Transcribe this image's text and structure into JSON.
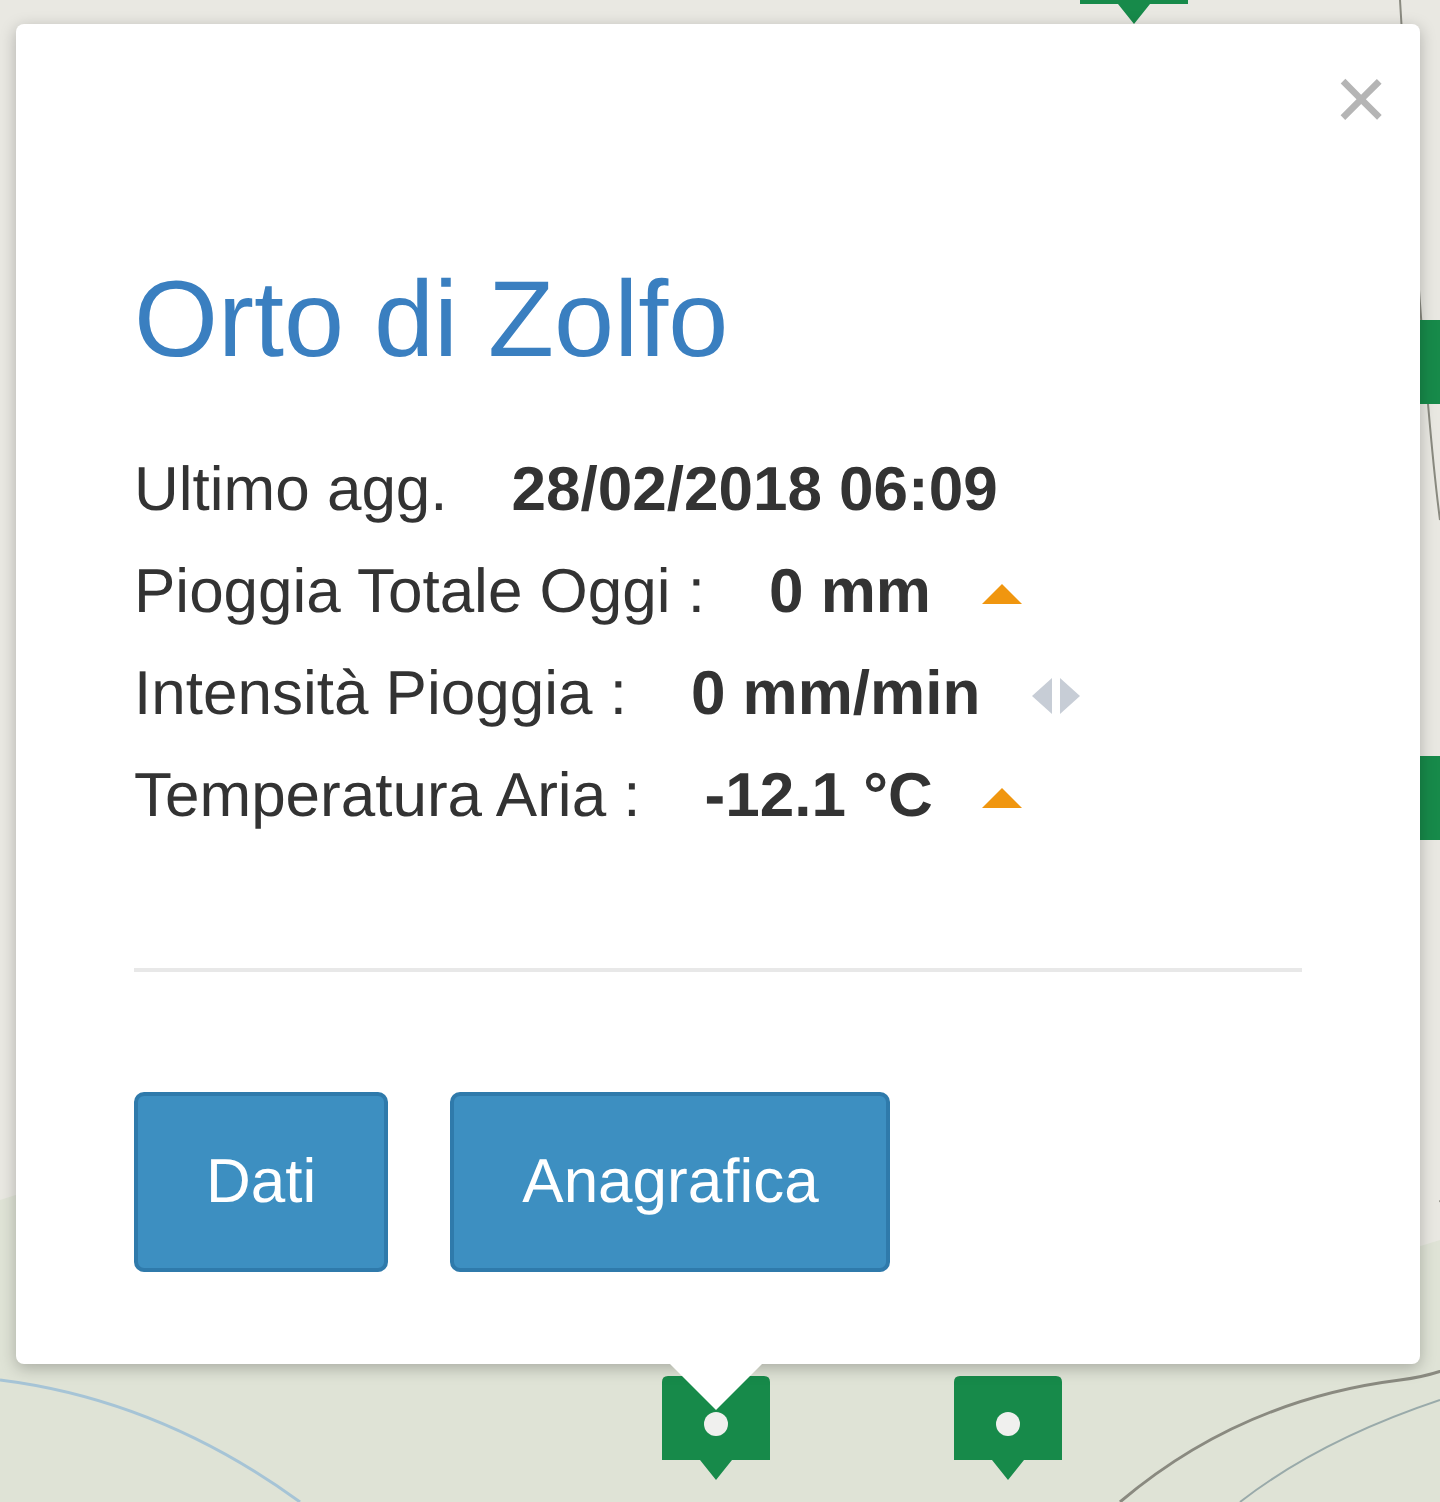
{
  "popup": {
    "close": "×",
    "title": "Orto di Zolfo",
    "rows": [
      {
        "kind": "plain",
        "label": "Ultimo agg.",
        "value": "28/02/2018 06:09"
      },
      {
        "kind": "rising",
        "label": "Pioggia Totale Oggi :",
        "value": "0 mm"
      },
      {
        "kind": "steady",
        "label": "Intensità Pioggia :",
        "value": "0 mm/min"
      },
      {
        "kind": "rising",
        "label": "Temperatura Aria :",
        "value": "-12.1 °C"
      }
    ],
    "buttons": [
      "Dati",
      "Anagrafica"
    ]
  }
}
